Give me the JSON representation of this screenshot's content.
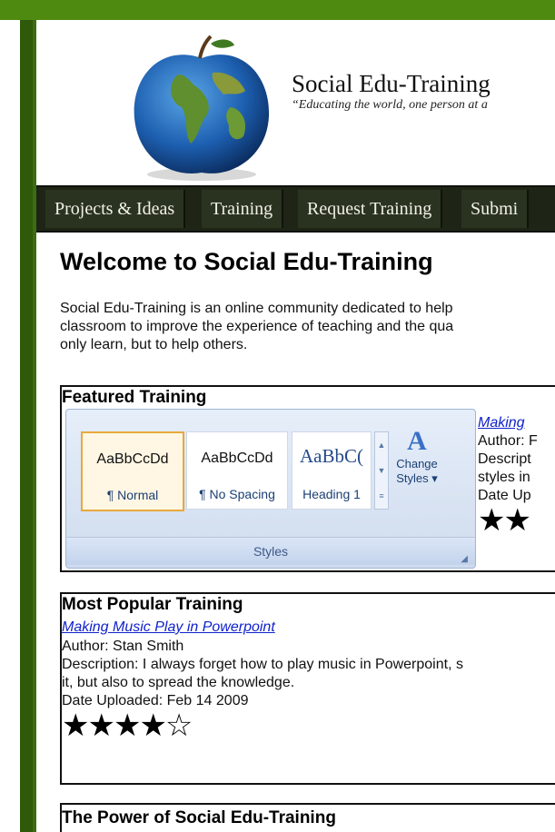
{
  "header": {
    "site_title": "Social Edu-Training",
    "tagline": "“Educating the world, one person at a"
  },
  "nav": {
    "items": [
      {
        "label": "Projects & Ideas"
      },
      {
        "label": "Training"
      },
      {
        "label": "Request Training"
      },
      {
        "label": "Submi"
      }
    ]
  },
  "main": {
    "title": "Welcome to Social Edu-Training",
    "intro_lines": [
      "Social Edu-Training is an online community dedicated to help",
      "classroom to improve the experience of teaching and the qua",
      "only learn, but to help others."
    ]
  },
  "featured": {
    "title": "Featured Training",
    "ribbon": {
      "styles": [
        {
          "sample": "AaBbCcDd",
          "name": "¶ Normal"
        },
        {
          "sample": "AaBbCcDd",
          "name": "¶ No Spacing"
        },
        {
          "sample": "AaBbC(",
          "name": "Heading 1"
        }
      ],
      "change_label_1": "Change",
      "change_label_2": "Styles ▾",
      "group_label": "Styles"
    },
    "link": "Making",
    "author": "Author: F",
    "desc_1": "Descript",
    "desc_2": "styles in",
    "date": "Date Up",
    "rating": 2,
    "stars_text": "★★"
  },
  "popular": {
    "title": "Most Popular Training",
    "link": "Making Music Play in Powerpoint",
    "author": "Author: Stan Smith",
    "desc_1": "Description: I always forget how to play music in Powerpoint, s",
    "desc_2": "it, but also to spread the knowledge.",
    "date": "Date Uploaded: Feb 14 2009",
    "rating": 4,
    "rating_max": 5,
    "stars_text": "★★★★☆"
  },
  "power": {
    "title": "The Power of Social Edu-Training"
  }
}
